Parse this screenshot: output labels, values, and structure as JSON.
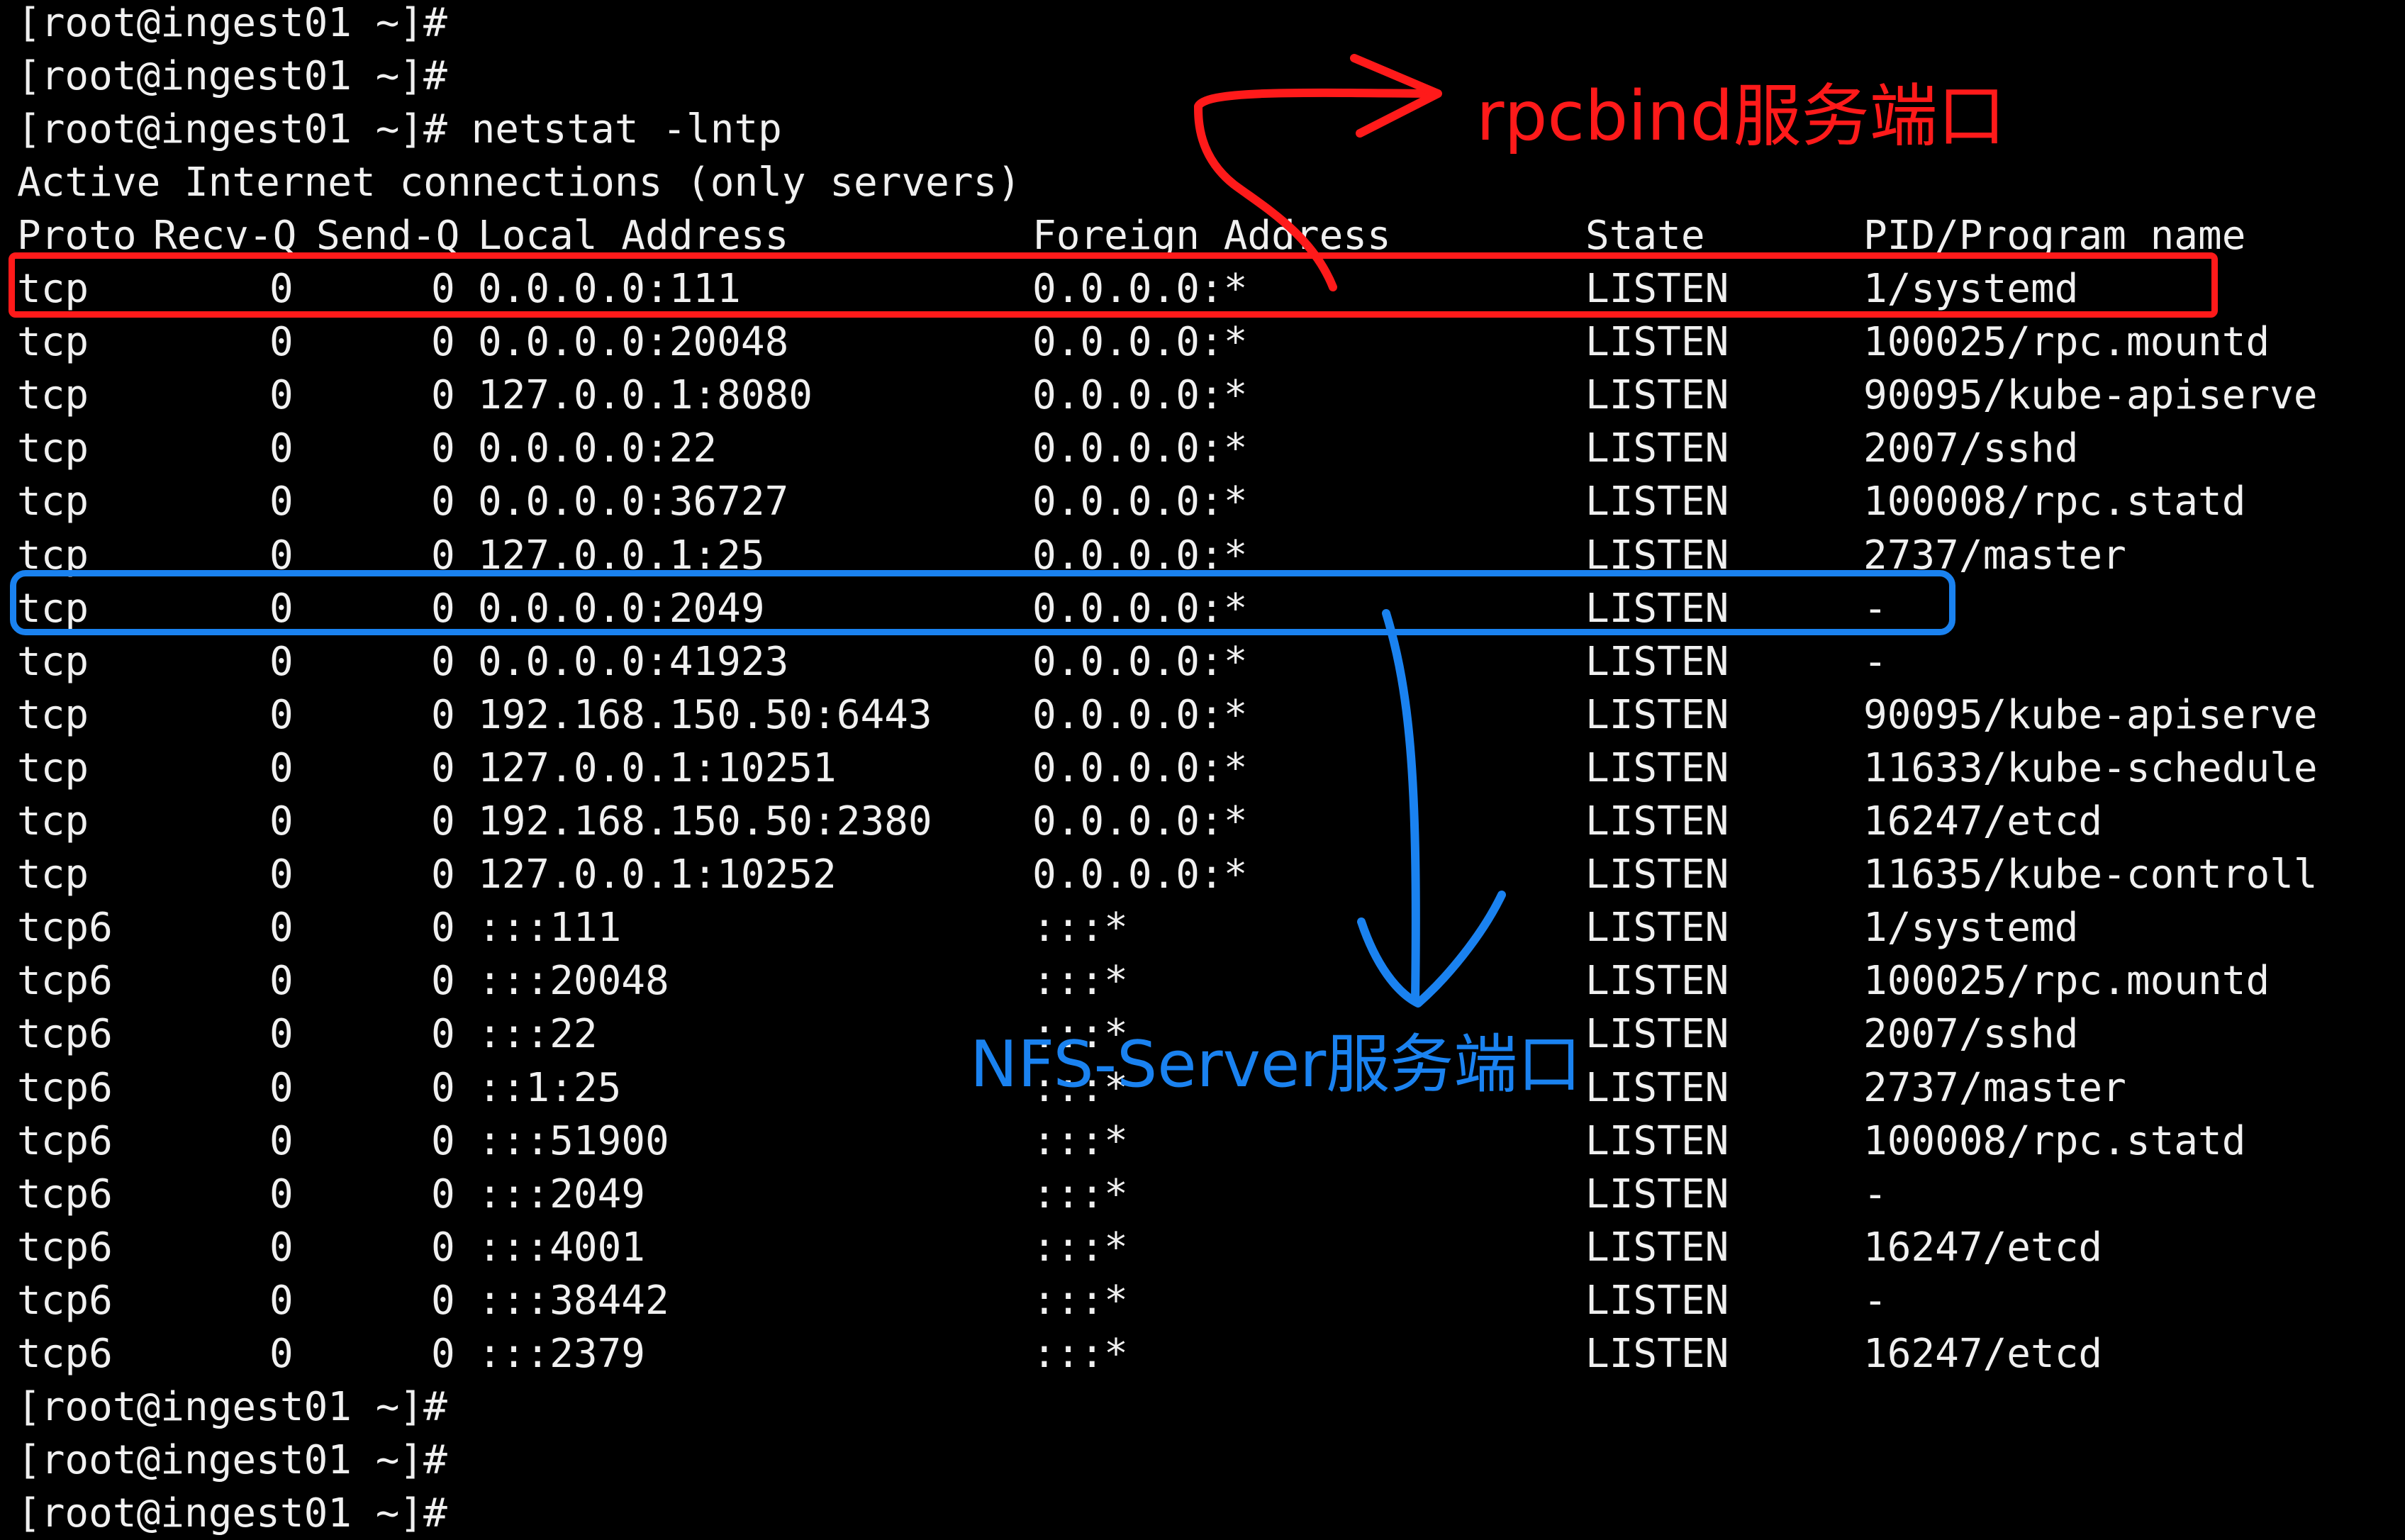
{
  "terminal": {
    "prompt": "[root@ingest01 ~]#",
    "lines_before": [
      "[root@ingest01 ~]#",
      "[root@ingest01 ~]#",
      "[root@ingest01 ~]# netstat -lntp",
      "Active Internet connections (only servers)"
    ],
    "header": {
      "proto": "Proto",
      "recv": "Recv-Q",
      "send": "Send-Q",
      "local": "Local Address",
      "foreign": "Foreign Address",
      "state": "State",
      "pid": "PID/Program name"
    },
    "rows": [
      {
        "proto": "tcp",
        "recv": "0",
        "send": "0",
        "local": "0.0.0.0:111",
        "foreign": "0.0.0.0:*",
        "state": "LISTEN",
        "pid": "1/systemd"
      },
      {
        "proto": "tcp",
        "recv": "0",
        "send": "0",
        "local": "0.0.0.0:20048",
        "foreign": "0.0.0.0:*",
        "state": "LISTEN",
        "pid": "100025/rpc.mountd"
      },
      {
        "proto": "tcp",
        "recv": "0",
        "send": "0",
        "local": "127.0.0.1:8080",
        "foreign": "0.0.0.0:*",
        "state": "LISTEN",
        "pid": "90095/kube-apiserve"
      },
      {
        "proto": "tcp",
        "recv": "0",
        "send": "0",
        "local": "0.0.0.0:22",
        "foreign": "0.0.0.0:*",
        "state": "LISTEN",
        "pid": "2007/sshd"
      },
      {
        "proto": "tcp",
        "recv": "0",
        "send": "0",
        "local": "0.0.0.0:36727",
        "foreign": "0.0.0.0:*",
        "state": "LISTEN",
        "pid": "100008/rpc.statd"
      },
      {
        "proto": "tcp",
        "recv": "0",
        "send": "0",
        "local": "127.0.0.1:25",
        "foreign": "0.0.0.0:*",
        "state": "LISTEN",
        "pid": "2737/master"
      },
      {
        "proto": "tcp",
        "recv": "0",
        "send": "0",
        "local": "0.0.0.0:2049",
        "foreign": "0.0.0.0:*",
        "state": "LISTEN",
        "pid": "-"
      },
      {
        "proto": "tcp",
        "recv": "0",
        "send": "0",
        "local": "0.0.0.0:41923",
        "foreign": "0.0.0.0:*",
        "state": "LISTEN",
        "pid": "-"
      },
      {
        "proto": "tcp",
        "recv": "0",
        "send": "0",
        "local": "192.168.150.50:6443",
        "foreign": "0.0.0.0:*",
        "state": "LISTEN",
        "pid": "90095/kube-apiserve"
      },
      {
        "proto": "tcp",
        "recv": "0",
        "send": "0",
        "local": "127.0.0.1:10251",
        "foreign": "0.0.0.0:*",
        "state": "LISTEN",
        "pid": "11633/kube-schedule"
      },
      {
        "proto": "tcp",
        "recv": "0",
        "send": "0",
        "local": "192.168.150.50:2380",
        "foreign": "0.0.0.0:*",
        "state": "LISTEN",
        "pid": "16247/etcd"
      },
      {
        "proto": "tcp",
        "recv": "0",
        "send": "0",
        "local": "127.0.0.1:10252",
        "foreign": "0.0.0.0:*",
        "state": "LISTEN",
        "pid": "11635/kube-controll"
      },
      {
        "proto": "tcp6",
        "recv": "0",
        "send": "0",
        "local": ":::111",
        "foreign": ":::*",
        "state": "LISTEN",
        "pid": "1/systemd"
      },
      {
        "proto": "tcp6",
        "recv": "0",
        "send": "0",
        "local": ":::20048",
        "foreign": ":::*",
        "state": "LISTEN",
        "pid": "100025/rpc.mountd"
      },
      {
        "proto": "tcp6",
        "recv": "0",
        "send": "0",
        "local": ":::22",
        "foreign": ":::*",
        "state": "LISTEN",
        "pid": "2007/sshd"
      },
      {
        "proto": "tcp6",
        "recv": "0",
        "send": "0",
        "local": "::1:25",
        "foreign": ":::*",
        "state": "LISTEN",
        "pid": "2737/master"
      },
      {
        "proto": "tcp6",
        "recv": "0",
        "send": "0",
        "local": ":::51900",
        "foreign": ":::*",
        "state": "LISTEN",
        "pid": "100008/rpc.statd"
      },
      {
        "proto": "tcp6",
        "recv": "0",
        "send": "0",
        "local": ":::2049",
        "foreign": ":::*",
        "state": "LISTEN",
        "pid": "-"
      },
      {
        "proto": "tcp6",
        "recv": "0",
        "send": "0",
        "local": ":::4001",
        "foreign": ":::*",
        "state": "LISTEN",
        "pid": "16247/etcd"
      },
      {
        "proto": "tcp6",
        "recv": "0",
        "send": "0",
        "local": ":::38442",
        "foreign": ":::*",
        "state": "LISTEN",
        "pid": "-"
      },
      {
        "proto": "tcp6",
        "recv": "0",
        "send": "0",
        "local": ":::2379",
        "foreign": ":::*",
        "state": "LISTEN",
        "pid": "16247/etcd"
      }
    ],
    "lines_after": [
      "[root@ingest01 ~]#",
      "[root@ingest01 ~]#",
      "[root@ingest01 ~]#"
    ]
  },
  "annotations": {
    "rpcbind": {
      "label": "rpcbind服务端口",
      "color": "#ff1a1a"
    },
    "nfs": {
      "label": "NFS-Server服务端口",
      "color": "#1a82f0"
    }
  },
  "colors": {
    "background": "#000000",
    "text": "#f0f0f0"
  }
}
